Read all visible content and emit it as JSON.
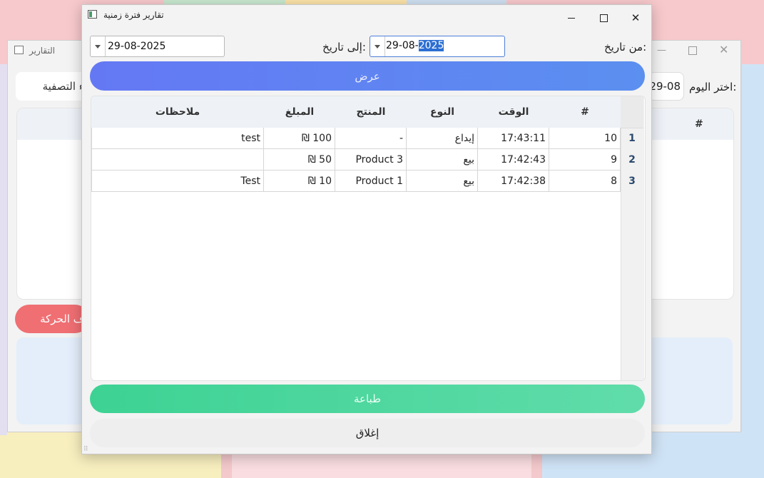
{
  "background_window": {
    "title": "التقارير",
    "today_label": "اختر اليوم:",
    "today_value": "29-08",
    "clear_filter_label": "اء التصفية",
    "delete_button_label": "ذف الحركة",
    "table_header_hash": "#"
  },
  "dialog": {
    "title": "تقارير فترة زمنية",
    "from_label": "من تاريخ:",
    "from_value_prefix": "29-08-",
    "from_value_selected": "2025",
    "to_label": "إلى تاريخ:",
    "to_value": "29-08-2025",
    "show_button": "عرض",
    "print_button": "طباعة",
    "close_button": "إغلاق",
    "table": {
      "headers": {
        "id": "#",
        "time": "الوقت",
        "type": "النوع",
        "product": "المنتج",
        "amount": "المبلغ",
        "notes": "ملاحظات"
      },
      "rows": [
        {
          "num": "1",
          "id": "10",
          "time": "17:43:11",
          "type": "إيداع",
          "product": "-",
          "amount": "₪ 100",
          "notes": "test"
        },
        {
          "num": "2",
          "id": "9",
          "time": "17:42:43",
          "type": "بيع",
          "product": "Product 3",
          "amount": "₪ 50",
          "notes": ""
        },
        {
          "num": "3",
          "id": "8",
          "time": "17:42:38",
          "type": "بيع",
          "product": "Product 1",
          "amount": "₪ 10",
          "notes": "Test"
        }
      ]
    }
  },
  "colors": {
    "show_button_gradient": [
      "#6478f4",
      "#5b8ff0"
    ],
    "print_button_gradient": [
      "#3dd294",
      "#60dcaa"
    ],
    "delete_button": "#ef6f73"
  }
}
